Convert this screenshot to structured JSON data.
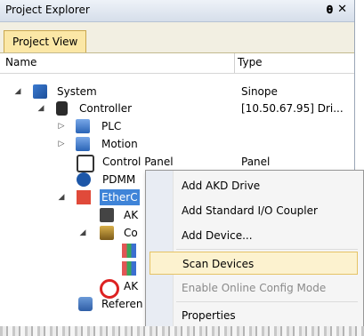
{
  "window": {
    "title": "Project Explorer",
    "pin_glyph": "Β",
    "close_glyph": "✕"
  },
  "tabs": [
    {
      "label": "Project View"
    }
  ],
  "columns": {
    "name": "Name",
    "type": "Type"
  },
  "tree": {
    "system": {
      "label": "System",
      "type": "Sinope"
    },
    "controller": {
      "label": "Controller",
      "type": "[10.50.67.95] Dri..."
    },
    "plc": {
      "label": "PLC"
    },
    "motion": {
      "label": "Motion"
    },
    "control_panel": {
      "label": "Control Panel",
      "type": "Panel"
    },
    "pdmm": {
      "label": "PDMM"
    },
    "ethercat": {
      "label": "EtherC"
    },
    "ak1": {
      "label": "AK"
    },
    "coupler": {
      "label": "Co"
    },
    "ak2": {
      "label": "AK"
    },
    "references": {
      "label": "Referen"
    }
  },
  "context_menu": {
    "items": [
      {
        "label": "Add AKD Drive"
      },
      {
        "label": "Add Standard I/O Coupler"
      },
      {
        "label": "Add Device..."
      },
      {
        "label": "Scan Devices",
        "selected": true
      },
      {
        "label": "Enable Online Config Mode",
        "disabled": true
      },
      {
        "label": "Properties"
      }
    ]
  },
  "colors": {
    "selection": "#3f84d8",
    "menu_hover": "#fcf2cf",
    "tab_active": "#fbe7a6"
  },
  "icons": {
    "system": "system-icon",
    "controller": "controller-icon",
    "plc": "plc-icon",
    "motion": "motion-icon",
    "control_panel": "control-panel-icon",
    "pdmm": "pdmm-icon",
    "ethercat": "ethercat-icon",
    "ak": "drive-icon",
    "coupler": "coupler-icon",
    "error": "error-icon",
    "references": "references-icon"
  }
}
